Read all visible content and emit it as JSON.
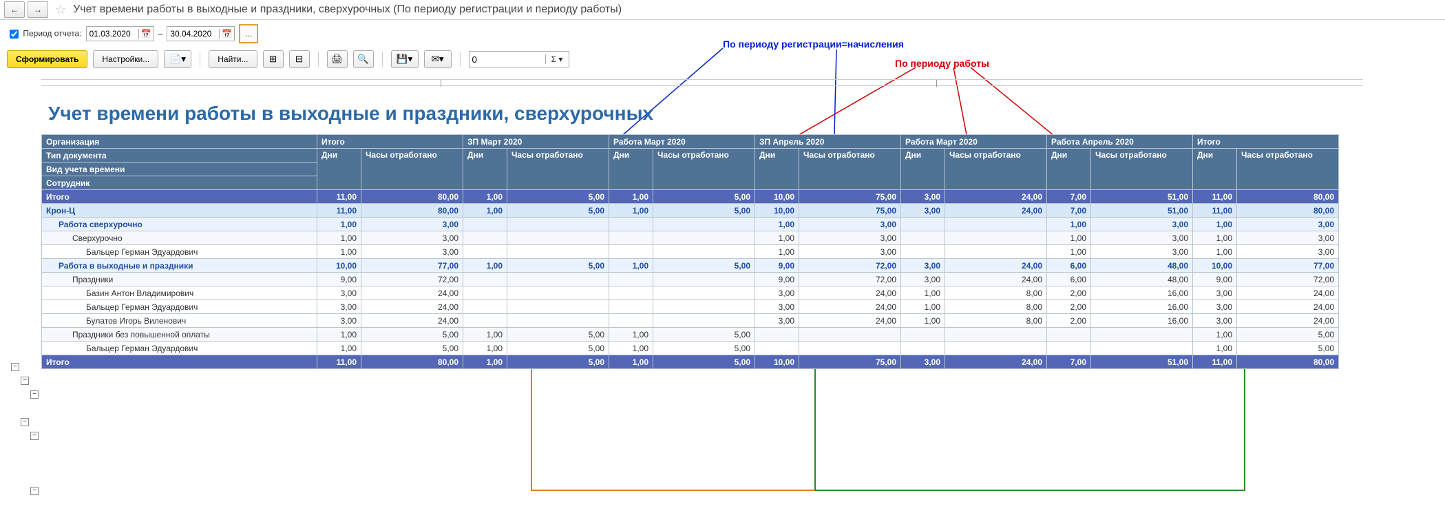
{
  "title": "Учет времени работы в выходные и праздники, сверхурочных (По периоду регистрации и периоду работы)",
  "period": {
    "checkbox_label": "Период отчета:",
    "from": "01.03.2020",
    "dash": "–",
    "to": "30.04.2020",
    "ellipsis": "..."
  },
  "toolbar": {
    "generate": "Сформировать",
    "settings": "Настройки...",
    "find": "Найти...",
    "sigma": "Σ"
  },
  "annotations": {
    "registration": "По периоду регистрации=начисления",
    "work": "По периоду работы"
  },
  "report": {
    "title": "Учет времени работы в выходные и праздники, сверхурочных",
    "headers": {
      "org": "Организация",
      "itogo": "Итого",
      "doc_type": "Тип документа",
      "time_account": "Вид учета времени",
      "employee": "Сотрудник",
      "days": "Дни",
      "hours": "Часы отработано",
      "sections": [
        "ЗП Март 2020",
        "Работа Март 2020",
        "ЗП Апрель 2020",
        "Работа Март 2020",
        "Работа Апрель 2020"
      ]
    },
    "rows": [
      {
        "class": "total-row",
        "label": "Итого",
        "vals": [
          "11,00",
          "80,00",
          "1,00",
          "5,00",
          "1,00",
          "5,00",
          "10,00",
          "75,00",
          "3,00",
          "24,00",
          "7,00",
          "51,00",
          "11,00",
          "80,00"
        ]
      },
      {
        "class": "grp1",
        "label": "Крон-Ц",
        "vals": [
          "11,00",
          "80,00",
          "1,00",
          "5,00",
          "1,00",
          "5,00",
          "10,00",
          "75,00",
          "3,00",
          "24,00",
          "7,00",
          "51,00",
          "11,00",
          "80,00"
        ]
      },
      {
        "class": "grp2",
        "label": "Работа сверхурочно",
        "ind": "ind1",
        "vals": [
          "1,00",
          "3,00",
          "",
          "",
          "",
          "",
          "1,00",
          "3,00",
          "",
          "",
          "1,00",
          "3,00",
          "1,00",
          "3,00"
        ]
      },
      {
        "class": "grp3",
        "label": "Сверхурочно",
        "ind": "ind2",
        "vals": [
          "1,00",
          "3,00",
          "",
          "",
          "",
          "",
          "1,00",
          "3,00",
          "",
          "",
          "1,00",
          "3,00",
          "1,00",
          "3,00"
        ]
      },
      {
        "class": "data",
        "label": "Бальцер Герман Эдуардович",
        "ind": "ind3",
        "vals": [
          "1,00",
          "3,00",
          "",
          "",
          "",
          "",
          "1,00",
          "3,00",
          "",
          "",
          "1,00",
          "3,00",
          "1,00",
          "3,00"
        ]
      },
      {
        "class": "grp2",
        "label": "Работа в выходные и праздники",
        "ind": "ind1",
        "vals": [
          "10,00",
          "77,00",
          "1,00",
          "5,00",
          "1,00",
          "5,00",
          "9,00",
          "72,00",
          "3,00",
          "24,00",
          "6,00",
          "48,00",
          "10,00",
          "77,00"
        ]
      },
      {
        "class": "grp3",
        "label": "Праздники",
        "ind": "ind2",
        "vals": [
          "9,00",
          "72,00",
          "",
          "",
          "",
          "",
          "9,00",
          "72,00",
          "3,00",
          "24,00",
          "6,00",
          "48,00",
          "9,00",
          "72,00"
        ]
      },
      {
        "class": "data",
        "label": "Базин Антон Владимирович",
        "ind": "ind3",
        "vals": [
          "3,00",
          "24,00",
          "",
          "",
          "",
          "",
          "3,00",
          "24,00",
          "1,00",
          "8,00",
          "2,00",
          "16,00",
          "3,00",
          "24,00"
        ]
      },
      {
        "class": "data",
        "label": "Бальцер Герман Эдуардович",
        "ind": "ind3",
        "vals": [
          "3,00",
          "24,00",
          "",
          "",
          "",
          "",
          "3,00",
          "24,00",
          "1,00",
          "8,00",
          "2,00",
          "16,00",
          "3,00",
          "24,00"
        ]
      },
      {
        "class": "data",
        "label": "Булатов Игорь Виленович",
        "ind": "ind3",
        "vals": [
          "3,00",
          "24,00",
          "",
          "",
          "",
          "",
          "3,00",
          "24,00",
          "1,00",
          "8,00",
          "2,00",
          "16,00",
          "3,00",
          "24,00"
        ]
      },
      {
        "class": "grp3",
        "label": "Праздники без повышенной оплаты",
        "ind": "ind2",
        "vals": [
          "1,00",
          "5,00",
          "1,00",
          "5,00",
          "1,00",
          "5,00",
          "",
          "",
          "",
          "",
          "",
          "",
          "1,00",
          "5,00"
        ]
      },
      {
        "class": "data",
        "label": "Бальцер Герман Эдуардович",
        "ind": "ind3",
        "vals": [
          "1,00",
          "5,00",
          "1,00",
          "5,00",
          "1,00",
          "5,00",
          "",
          "",
          "",
          "",
          "",
          "",
          "1,00",
          "5,00"
        ]
      },
      {
        "class": "total-row",
        "label": "Итого",
        "vals": [
          "11,00",
          "80,00",
          "1,00",
          "5,00",
          "1,00",
          "5,00",
          "10,00",
          "75,00",
          "3,00",
          "24,00",
          "7,00",
          "51,00",
          "11,00",
          "80,00"
        ]
      }
    ],
    "col_widths": {
      "label": 400,
      "d": 64,
      "h": 148
    }
  }
}
